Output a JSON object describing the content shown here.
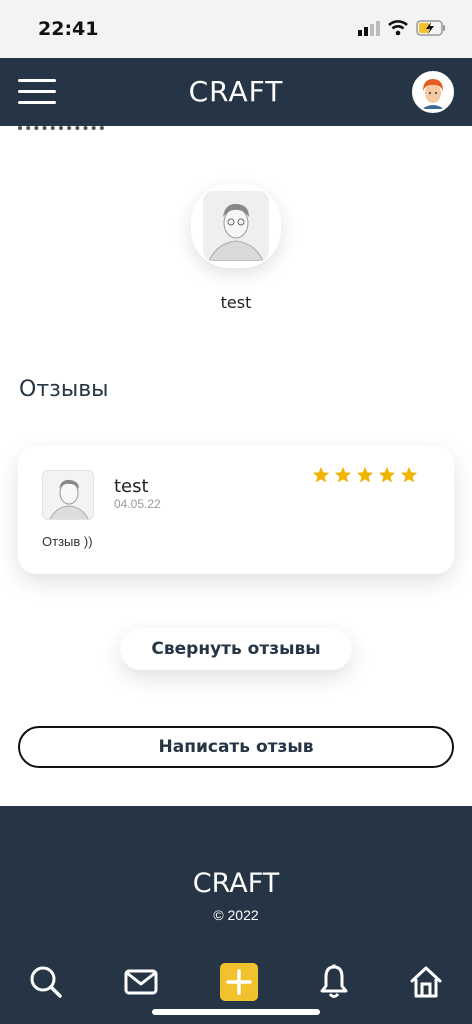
{
  "status_bar": {
    "time": "22:41"
  },
  "header": {
    "brand": "CRAFT"
  },
  "profile": {
    "name": "test"
  },
  "reviews": {
    "title": "Отзывы",
    "items": [
      {
        "author": "test",
        "date": "04.05.22",
        "rating": 5,
        "text": "Отзыв ))"
      }
    ],
    "collapse_label": "Свернуть отзывы",
    "write_label": "Написать отзыв"
  },
  "footer": {
    "brand": "CRAFT",
    "copyright": "© 2022"
  },
  "colors": {
    "navy": "#263545",
    "accent": "#f2c12e",
    "star": "#f0b400"
  },
  "bottom_nav": [
    "search-icon",
    "mail-icon",
    "add-icon",
    "bell-icon",
    "home-icon"
  ]
}
